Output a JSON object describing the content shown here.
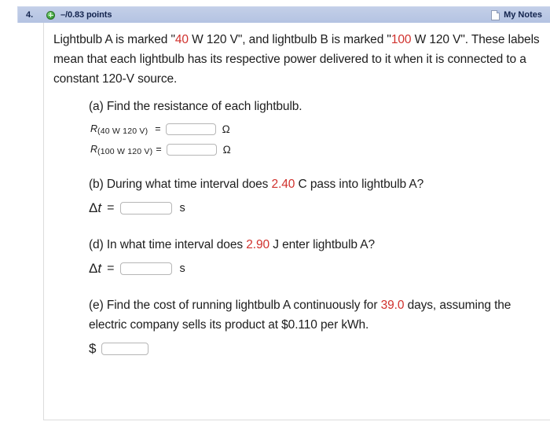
{
  "header": {
    "question_number": "4.",
    "expand_icon": "plus-circle-icon",
    "points": "–/0.83 points",
    "notes_icon": "note-page-icon",
    "notes_label": "My Notes"
  },
  "question": {
    "stem": {
      "seg1": "Lightbulb A is marked \"",
      "value1": "40",
      "seg2": " W 120 V\", and lightbulb B is marked \"",
      "value2": "100",
      "seg3": " W 120 V\". These labels mean that each lightbulb has its respective power delivered to it when it is connected to a constant 120-V source."
    },
    "parts": [
      {
        "label": "(a) Find the resistance of each lightbulb.",
        "rows": [
          {
            "symbol": "R",
            "subscript": "(40 W 120 V)",
            "equals": "=",
            "value": "",
            "unit": "Ω"
          },
          {
            "symbol": "R",
            "subscript": "(100 W 120 V)",
            "equals": "=",
            "value": "",
            "unit": "Ω"
          }
        ]
      },
      {
        "label_seg1": "(b) During what time interval does ",
        "label_value": "2.40",
        "label_seg2": " C pass into lightbulb A?",
        "answer": {
          "symbol": "Δt",
          "equals": "=",
          "value": "",
          "unit": "s"
        }
      },
      {
        "label_seg1": "(d) In what time interval does ",
        "label_value": "2.90",
        "label_seg2": " J enter lightbulb A?",
        "answer": {
          "symbol": "Δt",
          "equals": "=",
          "value": "",
          "unit": "s"
        }
      },
      {
        "label_seg1": "(e) Find the cost of running lightbulb A continuously for ",
        "label_value": "39.0",
        "label_seg2": " days, assuming the electric company sells its product at $0.110 per kWh.",
        "answer": {
          "symbol": "$",
          "value": ""
        }
      }
    ]
  },
  "colors": {
    "header_bar": "#b4c3e2",
    "header_text": "#12234d",
    "highlight_number": "#d0312d",
    "panel_border": "#dcdcdc"
  }
}
